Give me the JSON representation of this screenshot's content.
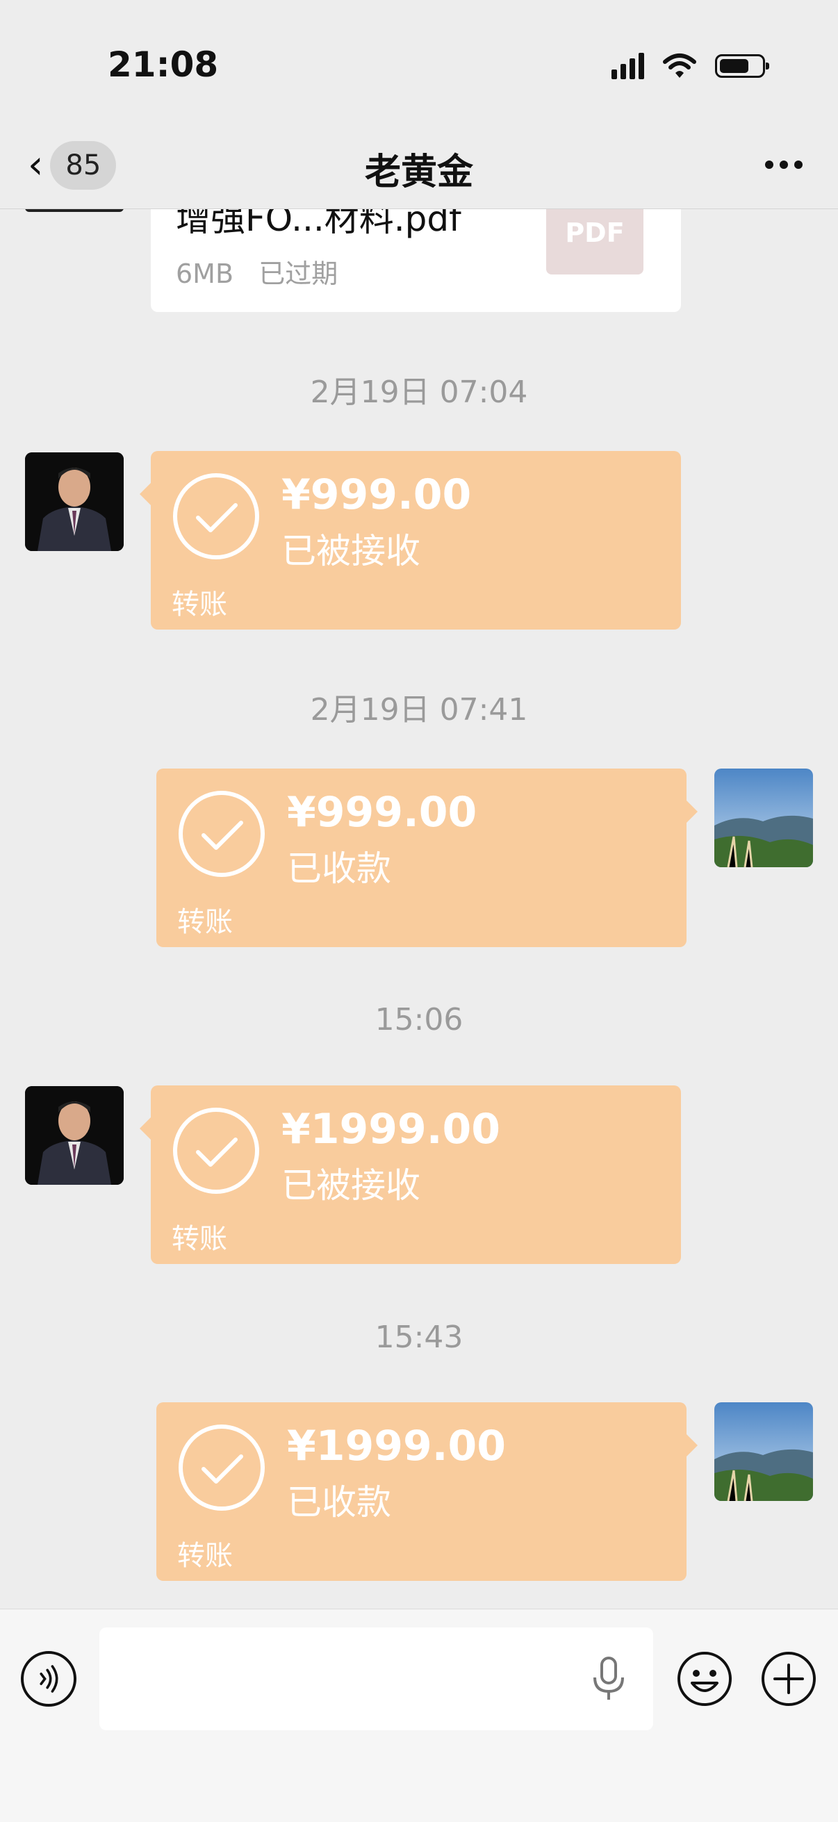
{
  "status_bar": {
    "time": "21:08",
    "signal_icon": "signal-icon",
    "wifi_icon": "wifi-icon",
    "battery_icon": "battery-icon",
    "battery_level": 0.7
  },
  "header": {
    "back_icon": "chevron-left-icon",
    "unread_count": "85",
    "title": "老黄金",
    "more_icon": "more-icon"
  },
  "file_message": {
    "file_name": "增强FO...材料.pdf",
    "size": "6MB",
    "status": "已过期",
    "file_type": "PDF"
  },
  "messages": [
    {
      "time": "2月19日 07:04",
      "side": "left",
      "amount": "¥999.00",
      "status": "已被接收",
      "label": "转账"
    },
    {
      "time": "2月19日 07:41",
      "side": "right",
      "amount": "¥999.00",
      "status": "已收款",
      "label": "转账"
    },
    {
      "time": "15:06",
      "side": "left",
      "amount": "¥1999.00",
      "status": "已被接收",
      "label": "转账"
    },
    {
      "time": "15:43",
      "side": "right",
      "amount": "¥1999.00",
      "status": "已收款",
      "label": "转账"
    }
  ],
  "input_bar": {
    "voice_icon": "voice-icon",
    "placeholder": "",
    "mic_icon": "microphone-icon",
    "emoji_icon": "emoji-icon",
    "plus_icon": "plus-icon"
  },
  "colors": {
    "transfer_bubble": "#f9cc9d",
    "background": "#ededed"
  }
}
